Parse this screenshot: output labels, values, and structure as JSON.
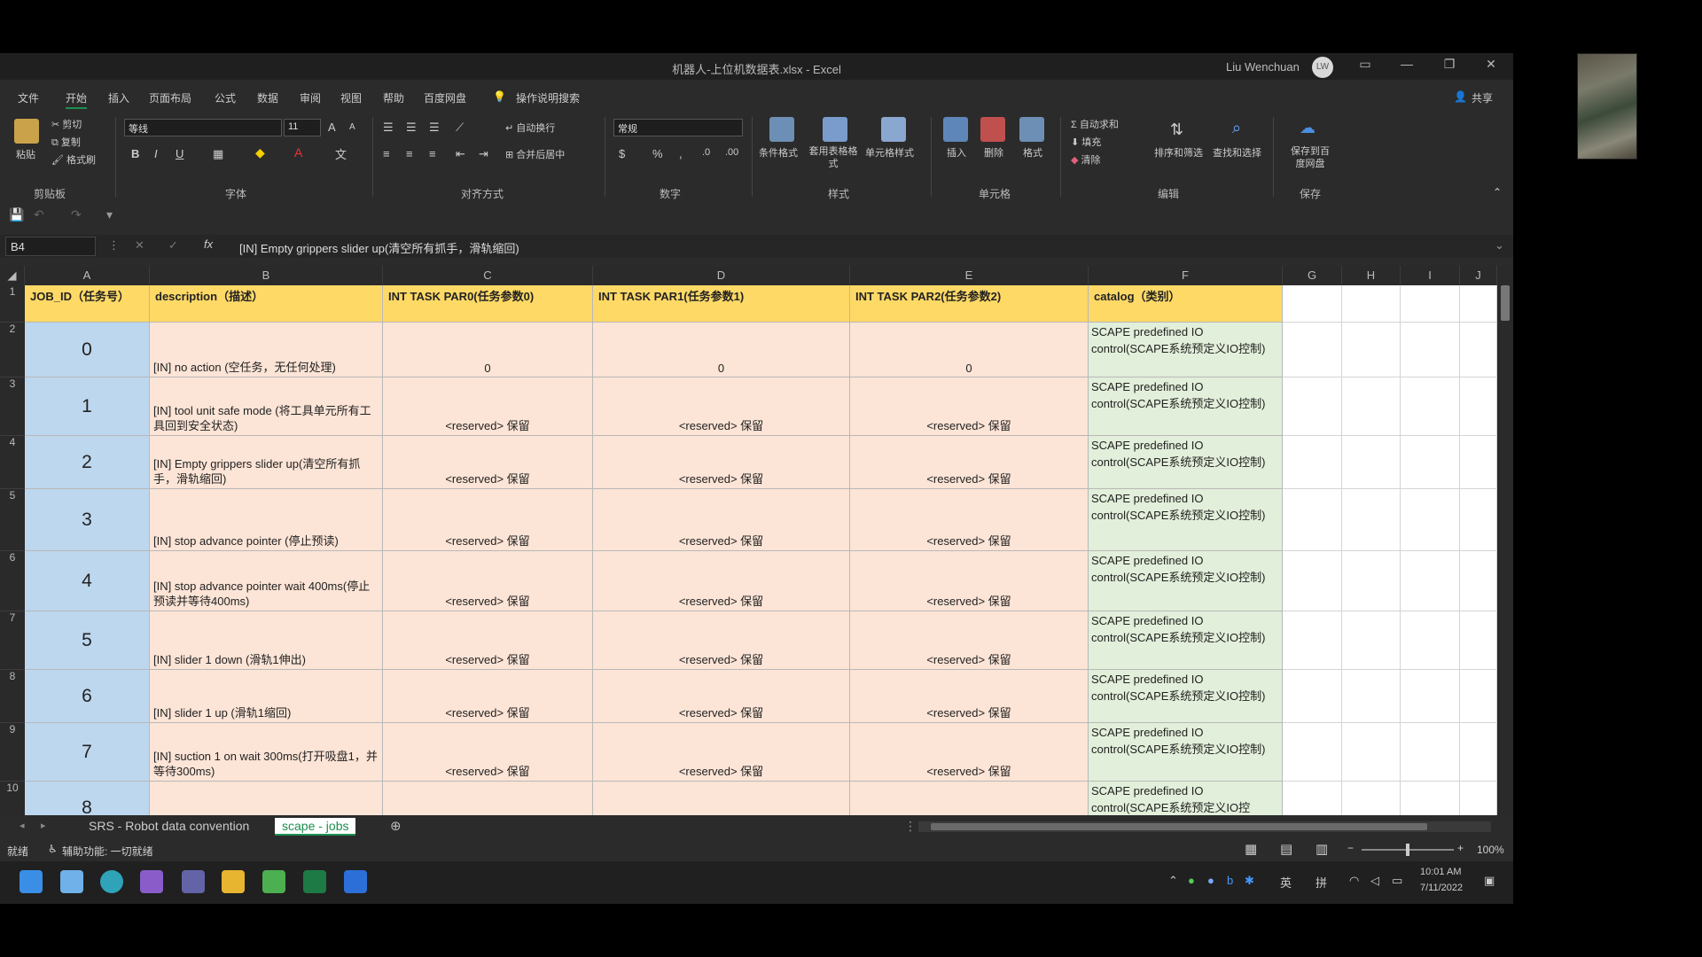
{
  "titlebar": {
    "title": "机器人-上位机数据表.xlsx  -  Excel",
    "user": "Liu Wenchuan",
    "avatar": "LW",
    "minimize": "—",
    "restore": "❐",
    "close": "✕"
  },
  "menu": [
    "文件",
    "开始",
    "插入",
    "页面布局",
    "公式",
    "数据",
    "审阅",
    "视图",
    "帮助",
    "百度网盘"
  ],
  "menu_active": 1,
  "search_label": "操作说明搜索",
  "share_label": "共享",
  "ribbon": {
    "clipboard": {
      "paste": "粘贴",
      "cut": "剪切",
      "copy": "复制",
      "format_painter": "格式刷",
      "group": "剪贴板"
    },
    "font": {
      "name": "等线",
      "size": "11",
      "group": "字体",
      "bold": "B",
      "italic": "I",
      "underline": "U",
      "grow": "A",
      "shrink": "A"
    },
    "align": {
      "wrap": "自动换行",
      "merge": "合并后居中",
      "group": "对齐方式"
    },
    "number": {
      "format": "常规",
      "currency": "$",
      "percent": "%",
      "comma": ",",
      "group": "数字"
    },
    "styles": {
      "cond": "条件格式",
      "table": "套用表格格式",
      "cell": "单元格样式",
      "group": "样式"
    },
    "cells": {
      "insert": "插入",
      "delete": "删除",
      "format": "格式",
      "group": "单元格"
    },
    "editing": {
      "autosum": "自动求和",
      "fill": "填充",
      "clear": "清除",
      "sort": "排序和筛选",
      "find": "查找和选择",
      "group": "编辑"
    },
    "save": {
      "save": "保存到百度网盘",
      "group": "保存"
    }
  },
  "formula_bar": {
    "name_box": "B4",
    "formula": "[IN] Empty grippers slider up(清空所有抓手，滑轨缩回)"
  },
  "columns": [
    "A",
    "B",
    "C",
    "D",
    "E",
    "F",
    "G",
    "H",
    "I",
    "J"
  ],
  "headers": [
    "JOB_ID（任务号）",
    "description（描述）",
    "INT TASK PAR0(任务参数0)",
    "INT TASK PAR1(任务参数1)",
    "INT TASK PAR2(任务参数2)",
    "catalog（类别）"
  ],
  "rows": [
    {
      "num": "2",
      "id": "0",
      "desc": "[IN] no action (空任务，无任何处理)",
      "p0": "0",
      "p1": "0",
      "p2": "0",
      "cat": "SCAPE predefined IO control(SCAPE系统预定义IO控制)"
    },
    {
      "num": "3",
      "id": "1",
      "desc": "[IN] tool unit safe mode (将工具单元所有工具回到安全状态)",
      "p0": "<reserved> 保留",
      "p1": "<reserved> 保留",
      "p2": "<reserved> 保留",
      "cat": "SCAPE predefined IO control(SCAPE系统预定义IO控制)"
    },
    {
      "num": "4",
      "id": "2",
      "desc": "[IN] Empty grippers slider up(清空所有抓手，滑轨缩回)",
      "p0": "<reserved> 保留",
      "p1": "<reserved> 保留",
      "p2": "<reserved> 保留",
      "cat": "SCAPE predefined IO control(SCAPE系统预定义IO控制)"
    },
    {
      "num": "5",
      "id": "3",
      "desc": "[IN] stop advance pointer (停止预读)",
      "p0": "<reserved> 保留",
      "p1": "<reserved> 保留",
      "p2": "<reserved> 保留",
      "cat": "SCAPE predefined IO control(SCAPE系统预定义IO控制)"
    },
    {
      "num": "6",
      "id": "4",
      "desc": "[IN] stop advance pointer wait 400ms(停止预读并等待400ms)",
      "p0": "<reserved> 保留",
      "p1": "<reserved> 保留",
      "p2": "<reserved> 保留",
      "cat": "SCAPE predefined IO control(SCAPE系统预定义IO控制)"
    },
    {
      "num": "7",
      "id": "5",
      "desc": "[IN] slider 1 down (滑轨1伸出)",
      "p0": "<reserved> 保留",
      "p1": "<reserved> 保留",
      "p2": "<reserved> 保留",
      "cat": "SCAPE predefined IO control(SCAPE系统预定义IO控制)"
    },
    {
      "num": "8",
      "id": "6",
      "desc": "[IN] slider 1 up (滑轨1缩回)",
      "p0": "<reserved> 保留",
      "p1": "<reserved> 保留",
      "p2": "<reserved> 保留",
      "cat": "SCAPE predefined IO control(SCAPE系统预定义IO控制)"
    },
    {
      "num": "9",
      "id": "7",
      "desc": "[IN] suction 1 on wait 300ms(打开吸盘1，并等待300ms)",
      "p0": "<reserved> 保留",
      "p1": "<reserved> 保留",
      "p2": "<reserved> 保留",
      "cat": "SCAPE predefined IO control(SCAPE系统预定义IO控制)"
    },
    {
      "num": "10",
      "id": "8",
      "desc": "",
      "p0": "",
      "p1": "",
      "p2": "",
      "cat": "SCAPE predefined IO control(SCAPE系统预定义IO控"
    }
  ],
  "sheets": [
    "SRS - Robot data convention",
    "scape - jobs"
  ],
  "active_sheet": 1,
  "status": {
    "ready": "就绪",
    "accessibility": "辅助功能: 一切就绪",
    "zoom": "100%"
  },
  "tray": {
    "ime1": "英",
    "ime2": "拼",
    "time": "10:01 AM",
    "date": "7/11/2022"
  }
}
